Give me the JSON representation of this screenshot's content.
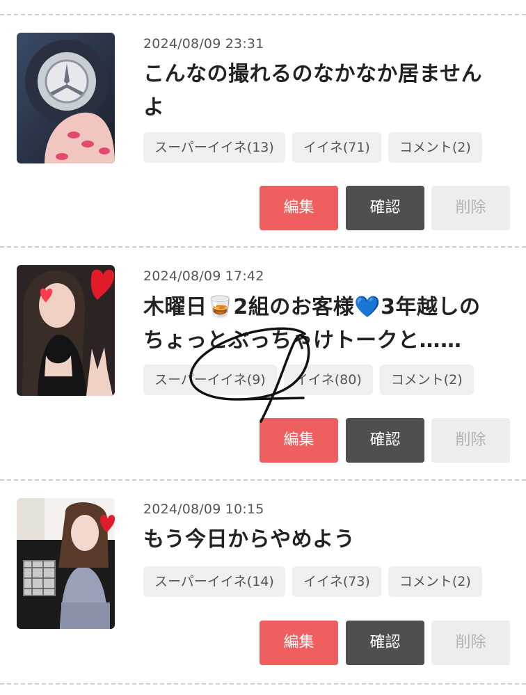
{
  "posts": [
    {
      "date": "2024/08/09 23:31",
      "title_lines": [
        "こんなの撮れるのなかなか居ません",
        "よ"
      ],
      "tags": {
        "super_like": "スーパーイイネ(13)",
        "like": "イイネ(71)",
        "comment": "コメント(2)"
      },
      "buttons": {
        "edit": "編集",
        "confirm": "確認",
        "delete": "削除"
      }
    },
    {
      "date": "2024/08/09 17:42",
      "title_lines": [
        "木曜日🥃2組のお客様💙3年越しの",
        "ちょっとぶっちゃけトークと……"
      ],
      "tags": {
        "super_like": "スーパーイイネ(9)",
        "like": "イイネ(80)",
        "comment": "コメント(2)"
      },
      "buttons": {
        "edit": "編集",
        "confirm": "確認",
        "delete": "削除"
      }
    },
    {
      "date": "2024/08/09 10:15",
      "title_lines": [
        "もう今日からやめよう"
      ],
      "tags": {
        "super_like": "スーパーイイネ(14)",
        "like": "イイネ(73)",
        "comment": "コメント(2)"
      },
      "buttons": {
        "edit": "編集",
        "confirm": "確認",
        "delete": "削除"
      }
    }
  ],
  "colors": {
    "edit_button": "#ef5f5f",
    "confirm_button": "#4f4f4f",
    "delete_button": "#ededed",
    "tag_background": "#efefef",
    "divider": "#cfcfcf"
  },
  "icons": [
    "post-thumbnail-image",
    "hand-drawn-scribble-mark"
  ]
}
